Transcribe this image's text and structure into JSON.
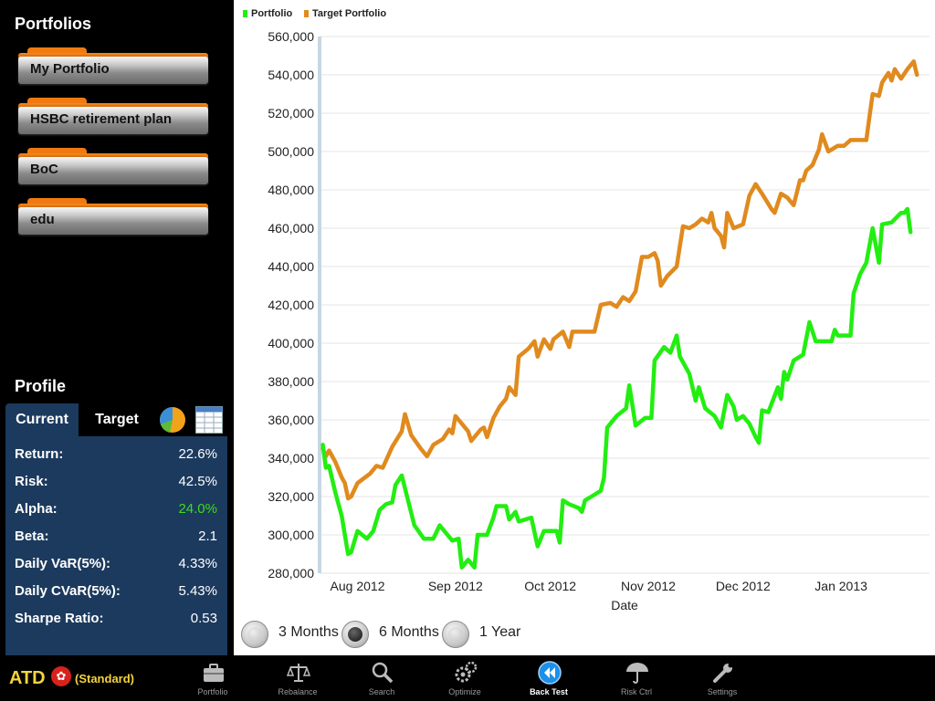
{
  "sidebar": {
    "portfolios_title": "Portfolios",
    "portfolios": [
      {
        "label": "My Portfolio"
      },
      {
        "label": "HSBC retirement plan"
      },
      {
        "label": "BoC"
      },
      {
        "label": "edu"
      }
    ],
    "profile_title": "Profile",
    "tabs": [
      {
        "label": "Current",
        "active": true
      },
      {
        "label": "Target",
        "active": false
      }
    ],
    "view_icons": [
      "pie-chart-icon",
      "table-icon"
    ],
    "metrics": [
      {
        "label": "Return:",
        "value": "22.6%"
      },
      {
        "label": "Risk:",
        "value": "42.5%"
      },
      {
        "label": "Alpha:",
        "value": "24.0%",
        "color": "#3ddc1c"
      },
      {
        "label": "Beta:",
        "value": "2.1"
      },
      {
        "label": "Daily VaR(5%):",
        "value": "4.33%"
      },
      {
        "label": "Daily CVaR(5%):",
        "value": "5.43%"
      },
      {
        "label": "Sharpe Ratio:",
        "value": "0.53"
      }
    ]
  },
  "chart_data": {
    "type": "line",
    "title": "",
    "xlabel": "Date",
    "ylabel": "",
    "ylim": [
      280000,
      560000
    ],
    "yticks": [
      280000,
      300000,
      320000,
      340000,
      360000,
      380000,
      400000,
      420000,
      440000,
      460000,
      480000,
      500000,
      520000,
      540000,
      560000
    ],
    "ytick_labels": [
      "280,000",
      "300,000",
      "320,000",
      "340,000",
      "360,000",
      "380,000",
      "400,000",
      "420,000",
      "440,000",
      "460,000",
      "480,000",
      "500,000",
      "520,000",
      "540,000",
      "560,000"
    ],
    "xlim": [
      "2012-07-20",
      "2013-01-29"
    ],
    "xticks": [
      "2012-08-01",
      "2012-09-01",
      "2012-10-01",
      "2012-11-01",
      "2012-12-01",
      "2013-01-01"
    ],
    "xtick_labels": [
      "Aug 2012",
      "Sep 2012",
      "Oct 2012",
      "Nov 2012",
      "Dec 2012",
      "Jan 2013"
    ],
    "grid": true,
    "legend_position": "top-left",
    "series": [
      {
        "name": "Portfolio",
        "color": "#22ee11",
        "points": [
          [
            "2012-07-21",
            347000
          ],
          [
            "2012-07-22",
            335000
          ],
          [
            "2012-07-23",
            336000
          ],
          [
            "2012-07-25",
            322000
          ],
          [
            "2012-07-27",
            310000
          ],
          [
            "2012-07-29",
            290000
          ],
          [
            "2012-07-30",
            291000
          ],
          [
            "2012-08-01",
            302000
          ],
          [
            "2012-08-04",
            298000
          ],
          [
            "2012-08-06",
            302000
          ],
          [
            "2012-08-08",
            313000
          ],
          [
            "2012-08-10",
            316000
          ],
          [
            "2012-08-12",
            317000
          ],
          [
            "2012-08-13",
            326000
          ],
          [
            "2012-08-15",
            331000
          ],
          [
            "2012-08-17",
            318000
          ],
          [
            "2012-08-19",
            305000
          ],
          [
            "2012-08-22",
            298000
          ],
          [
            "2012-08-25",
            298000
          ],
          [
            "2012-08-27",
            305000
          ],
          [
            "2012-08-29",
            301000
          ],
          [
            "2012-08-31",
            297000
          ],
          [
            "2012-09-02",
            298000
          ],
          [
            "2012-09-03",
            283000
          ],
          [
            "2012-09-05",
            287000
          ],
          [
            "2012-09-07",
            283000
          ],
          [
            "2012-09-08",
            300000
          ],
          [
            "2012-09-11",
            300000
          ],
          [
            "2012-09-13",
            309000
          ],
          [
            "2012-09-14",
            315000
          ],
          [
            "2012-09-17",
            315000
          ],
          [
            "2012-09-18",
            308000
          ],
          [
            "2012-09-20",
            312000
          ],
          [
            "2012-09-21",
            307000
          ],
          [
            "2012-09-25",
            309000
          ],
          [
            "2012-09-27",
            294000
          ],
          [
            "2012-09-29",
            302000
          ],
          [
            "2012-10-03",
            302000
          ],
          [
            "2012-10-04",
            296000
          ],
          [
            "2012-10-05",
            318000
          ],
          [
            "2012-10-07",
            316000
          ],
          [
            "2012-10-10",
            314000
          ],
          [
            "2012-10-11",
            312000
          ],
          [
            "2012-10-12",
            318000
          ],
          [
            "2012-10-14",
            320000
          ],
          [
            "2012-10-17",
            323000
          ],
          [
            "2012-10-18",
            330000
          ],
          [
            "2012-10-19",
            356000
          ],
          [
            "2012-10-22",
            362000
          ],
          [
            "2012-10-25",
            366000
          ],
          [
            "2012-10-26",
            378000
          ],
          [
            "2012-10-28",
            357000
          ],
          [
            "2012-10-31",
            361000
          ],
          [
            "2012-11-02",
            361000
          ],
          [
            "2012-11-03",
            391000
          ],
          [
            "2012-11-06",
            398000
          ],
          [
            "2012-11-08",
            395000
          ],
          [
            "2012-11-10",
            404000
          ],
          [
            "2012-11-11",
            393000
          ],
          [
            "2012-11-14",
            384000
          ],
          [
            "2012-11-16",
            370000
          ],
          [
            "2012-11-17",
            377000
          ],
          [
            "2012-11-19",
            366000
          ],
          [
            "2012-11-22",
            362000
          ],
          [
            "2012-11-24",
            356000
          ],
          [
            "2012-11-26",
            373000
          ],
          [
            "2012-11-28",
            367000
          ],
          [
            "2012-11-29",
            360000
          ],
          [
            "2012-12-01",
            362000
          ],
          [
            "2012-12-03",
            358000
          ],
          [
            "2012-12-05",
            351000
          ],
          [
            "2012-12-06",
            348000
          ],
          [
            "2012-12-07",
            365000
          ],
          [
            "2012-12-09",
            364000
          ],
          [
            "2012-12-12",
            377000
          ],
          [
            "2012-12-13",
            371000
          ],
          [
            "2012-12-14",
            385000
          ],
          [
            "2012-12-15",
            381000
          ],
          [
            "2012-12-17",
            391000
          ],
          [
            "2012-12-20",
            394000
          ],
          [
            "2012-12-22",
            411000
          ],
          [
            "2012-12-24",
            401000
          ],
          [
            "2012-12-29",
            401000
          ],
          [
            "2012-12-30",
            407000
          ],
          [
            "2012-12-31",
            404000
          ],
          [
            "2013-01-04",
            404000
          ],
          [
            "2013-01-05",
            426000
          ],
          [
            "2013-01-07",
            436000
          ],
          [
            "2013-01-09",
            442000
          ],
          [
            "2013-01-11",
            460000
          ],
          [
            "2013-01-13",
            442000
          ],
          [
            "2013-01-14",
            462000
          ],
          [
            "2013-01-17",
            463000
          ],
          [
            "2013-01-20",
            468000
          ],
          [
            "2013-01-21",
            468000
          ],
          [
            "2013-01-22",
            470000
          ],
          [
            "2013-01-23",
            458000
          ]
        ]
      },
      {
        "name": "Target Portfolio",
        "color": "#e08a1e",
        "points": [
          [
            "2012-07-21",
            345000
          ],
          [
            "2012-07-22",
            341000
          ],
          [
            "2012-07-23",
            344000
          ],
          [
            "2012-07-25",
            338000
          ],
          [
            "2012-07-27",
            330000
          ],
          [
            "2012-07-28",
            327000
          ],
          [
            "2012-07-29",
            319000
          ],
          [
            "2012-07-30",
            320000
          ],
          [
            "2012-08-01",
            327000
          ],
          [
            "2012-08-05",
            332000
          ],
          [
            "2012-08-07",
            336000
          ],
          [
            "2012-08-09",
            335000
          ],
          [
            "2012-08-12",
            346000
          ],
          [
            "2012-08-15",
            354000
          ],
          [
            "2012-08-16",
            363000
          ],
          [
            "2012-08-18",
            352000
          ],
          [
            "2012-08-21",
            345000
          ],
          [
            "2012-08-23",
            341000
          ],
          [
            "2012-08-25",
            347000
          ],
          [
            "2012-08-28",
            350000
          ],
          [
            "2012-08-30",
            355000
          ],
          [
            "2012-08-31",
            353000
          ],
          [
            "2012-09-01",
            362000
          ],
          [
            "2012-09-03",
            358000
          ],
          [
            "2012-09-05",
            354000
          ],
          [
            "2012-09-06",
            349000
          ],
          [
            "2012-09-09",
            355000
          ],
          [
            "2012-09-10",
            356000
          ],
          [
            "2012-09-11",
            351000
          ],
          [
            "2012-09-13",
            361000
          ],
          [
            "2012-09-15",
            367000
          ],
          [
            "2012-09-17",
            371000
          ],
          [
            "2012-09-18",
            377000
          ],
          [
            "2012-09-20",
            373000
          ],
          [
            "2012-09-21",
            393000
          ],
          [
            "2012-09-24",
            397000
          ],
          [
            "2012-09-26",
            401000
          ],
          [
            "2012-09-27",
            393000
          ],
          [
            "2012-09-29",
            402000
          ],
          [
            "2012-10-01",
            397000
          ],
          [
            "2012-10-02",
            402000
          ],
          [
            "2012-10-05",
            406000
          ],
          [
            "2012-10-07",
            398000
          ],
          [
            "2012-10-08",
            406000
          ],
          [
            "2012-10-10",
            406000
          ],
          [
            "2012-10-12",
            406000
          ],
          [
            "2012-10-15",
            406000
          ],
          [
            "2012-10-17",
            420000
          ],
          [
            "2012-10-20",
            421000
          ],
          [
            "2012-10-22",
            419000
          ],
          [
            "2012-10-24",
            424000
          ],
          [
            "2012-10-26",
            422000
          ],
          [
            "2012-10-28",
            427000
          ],
          [
            "2012-10-30",
            445000
          ],
          [
            "2012-11-01",
            445000
          ],
          [
            "2012-11-03",
            447000
          ],
          [
            "2012-11-04",
            443000
          ],
          [
            "2012-11-05",
            430000
          ],
          [
            "2012-11-07",
            435000
          ],
          [
            "2012-11-10",
            440000
          ],
          [
            "2012-11-12",
            461000
          ],
          [
            "2012-11-14",
            460000
          ],
          [
            "2012-11-16",
            462000
          ],
          [
            "2012-11-18",
            465000
          ],
          [
            "2012-11-20",
            463000
          ],
          [
            "2012-11-21",
            468000
          ],
          [
            "2012-11-22",
            460000
          ],
          [
            "2012-11-24",
            456000
          ],
          [
            "2012-11-25",
            450000
          ],
          [
            "2012-11-26",
            468000
          ],
          [
            "2012-11-28",
            460000
          ],
          [
            "2012-12-01",
            462000
          ],
          [
            "2012-12-03",
            477000
          ],
          [
            "2012-12-05",
            483000
          ],
          [
            "2012-12-07",
            478000
          ],
          [
            "2012-12-10",
            470000
          ],
          [
            "2012-12-11",
            468000
          ],
          [
            "2012-12-13",
            478000
          ],
          [
            "2012-12-15",
            476000
          ],
          [
            "2012-12-17",
            472000
          ],
          [
            "2012-12-19",
            485000
          ],
          [
            "2012-12-20",
            485000
          ],
          [
            "2012-12-21",
            490000
          ],
          [
            "2012-12-23",
            493000
          ],
          [
            "2012-12-25",
            501000
          ],
          [
            "2012-12-26",
            509000
          ],
          [
            "2012-12-28",
            500000
          ],
          [
            "2012-12-31",
            503000
          ],
          [
            "2013-01-02",
            503000
          ],
          [
            "2013-01-04",
            506000
          ],
          [
            "2013-01-06",
            506000
          ],
          [
            "2013-01-09",
            506000
          ],
          [
            "2013-01-10",
            518000
          ],
          [
            "2013-01-11",
            530000
          ],
          [
            "2013-01-13",
            529000
          ],
          [
            "2013-01-14",
            536000
          ],
          [
            "2013-01-16",
            541000
          ],
          [
            "2013-01-17",
            537000
          ],
          [
            "2013-01-18",
            543000
          ],
          [
            "2013-01-20",
            538000
          ],
          [
            "2013-01-22",
            543000
          ],
          [
            "2013-01-24",
            547000
          ],
          [
            "2013-01-25",
            540000
          ]
        ]
      }
    ]
  },
  "range_options": [
    {
      "label": "3 Months",
      "selected": false
    },
    {
      "label": "6 Months",
      "selected": true
    },
    {
      "label": "1 Year",
      "selected": false
    }
  ],
  "bottombar": {
    "brand": "ATD",
    "emblem_icon": "hk-flag-icon",
    "edition": "(Standard)",
    "nav": [
      {
        "label": "Portfolio",
        "icon": "briefcase-icon",
        "active": false
      },
      {
        "label": "Rebalance",
        "icon": "scales-icon",
        "active": false
      },
      {
        "label": "Search",
        "icon": "magnifier-icon",
        "active": false
      },
      {
        "label": "Optimize",
        "icon": "gears-icon",
        "active": false
      },
      {
        "label": "Back Test",
        "icon": "rewind-icon",
        "active": true
      },
      {
        "label": "Risk Ctrl",
        "icon": "umbrella-icon",
        "active": false
      },
      {
        "label": "Settings",
        "icon": "wrench-icon",
        "active": false
      }
    ]
  }
}
